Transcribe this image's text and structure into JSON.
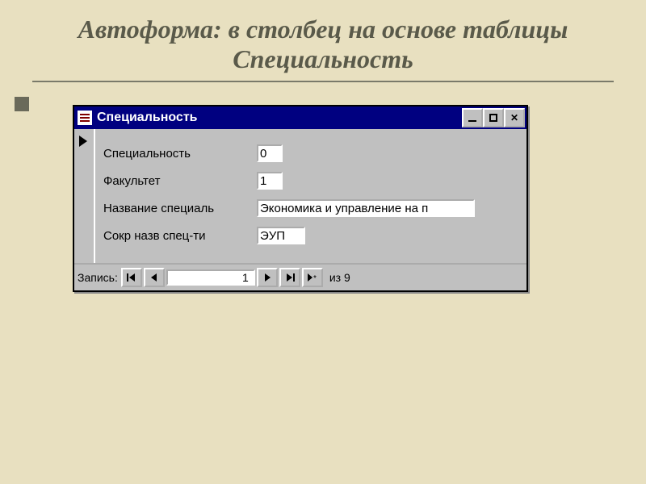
{
  "slide": {
    "title": "Автоформа: в столбец на основе таблицы Специальность"
  },
  "window": {
    "title": "Специальность"
  },
  "fields": {
    "f1": {
      "label": "Специальность",
      "value": "0"
    },
    "f2": {
      "label": "Факультет",
      "value": "1"
    },
    "f3": {
      "label": "Название специаль",
      "value": "Экономика и управление на п"
    },
    "f4": {
      "label": "Сокр назв спец-ти",
      "value": "ЭУП"
    }
  },
  "nav": {
    "label": "Запись:",
    "current": "1",
    "of": "из  9"
  }
}
